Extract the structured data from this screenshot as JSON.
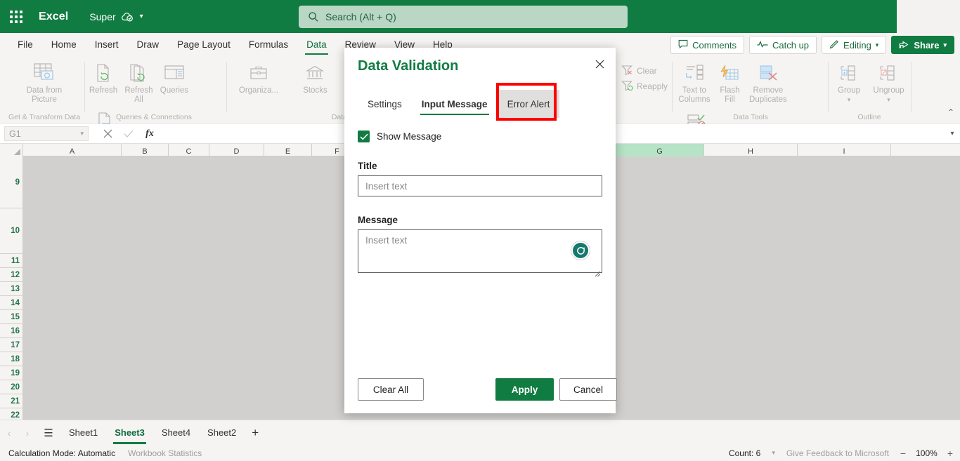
{
  "titlebar": {
    "app_name": "Excel",
    "file_name": "Super",
    "waffle_icon": "app-launcher-icon",
    "cloud_icon": "cloud-saved-icon",
    "file_chevron": "chevron-down-icon",
    "search": {
      "placeholder": "Search (Alt + Q)",
      "icon": "search-icon"
    }
  },
  "ribbon": {
    "tabs": [
      {
        "label": "File",
        "active": false
      },
      {
        "label": "Home",
        "active": false
      },
      {
        "label": "Insert",
        "active": false
      },
      {
        "label": "Draw",
        "active": false
      },
      {
        "label": "Page Layout",
        "active": false
      },
      {
        "label": "Formulas",
        "active": false
      },
      {
        "label": "Data",
        "active": true
      },
      {
        "label": "Review",
        "active": false
      },
      {
        "label": "View",
        "active": false
      },
      {
        "label": "Help",
        "active": false
      }
    ],
    "actions": {
      "comments": "Comments",
      "catch_up": "Catch up",
      "editing": "Editing",
      "share": "Share"
    },
    "groups": [
      {
        "label": "Get & Transform Data",
        "items": [
          "Data from Picture"
        ]
      },
      {
        "label": "Queries & Connections",
        "items": [
          "Refresh",
          "Refresh All",
          "Queries",
          "Workbook Links"
        ]
      },
      {
        "label": "Data",
        "items": [
          "Organiza...",
          "Stocks"
        ]
      },
      {
        "label": "Sort & Filter",
        "items": [
          "Clear",
          "Reapply"
        ]
      },
      {
        "label": "Data Tools",
        "items": [
          "Text to Columns",
          "Flash Fill",
          "Remove Duplicates",
          "Data Validation"
        ]
      },
      {
        "label": "Outline",
        "items": [
          "Group",
          "Ungroup"
        ]
      }
    ],
    "collapse_caret": "collapse-ribbon-caret"
  },
  "formula_bar": {
    "name_box_value": "G1",
    "name_box_chevron": "chevron-down-icon",
    "cancel_icon": "cancel-icon",
    "confirm_icon": "confirm-icon",
    "fx_label": "fx",
    "formula_value": "",
    "expand_chevron": "chevron-down-icon"
  },
  "grid": {
    "columns": [
      "A",
      "B",
      "C",
      "D",
      "E",
      "F",
      "G",
      "H",
      "I"
    ],
    "selected_column": "G",
    "rows": [
      "9",
      "10",
      "11",
      "12",
      "13",
      "14",
      "15",
      "16",
      "17",
      "18",
      "19",
      "20",
      "21",
      "22"
    ]
  },
  "dialog": {
    "title": "Data Validation",
    "close_icon": "close-icon",
    "tabs": [
      {
        "label": "Settings",
        "active": false,
        "highlighted": false
      },
      {
        "label": "Input Message",
        "active": true,
        "highlighted": false
      },
      {
        "label": "Error Alert",
        "active": false,
        "highlighted": true
      }
    ],
    "show_message": {
      "label": "Show Message",
      "checked": true,
      "check_icon": "checkmark-icon"
    },
    "title_field": {
      "label": "Title",
      "value": "",
      "placeholder": "Insert text"
    },
    "message_field": {
      "label": "Message",
      "value": "",
      "placeholder": "Insert text",
      "resize_handle": "resize-grip-icon"
    },
    "buttons": {
      "clear_all": "Clear All",
      "apply": "Apply",
      "cancel": "Cancel"
    },
    "highlight_color": "#ff0000",
    "accent_color": "#107c41",
    "cursor_indicator": "click-cursor-indicator"
  },
  "sheet_bar": {
    "prev_icon": "chevron-left-icon",
    "next_icon": "chevron-right-icon",
    "all_sheets_icon": "all-sheets-icon",
    "tabs": [
      {
        "label": "Sheet1",
        "active": false
      },
      {
        "label": "Sheet3",
        "active": true
      },
      {
        "label": "Sheet4",
        "active": false
      },
      {
        "label": "Sheet2",
        "active": false
      }
    ],
    "add_sheet_icon": "plus-icon"
  },
  "status_bar": {
    "calculation_mode": "Calculation Mode: Automatic",
    "workbook_statistics": "Workbook Statistics",
    "count": "Count: 6",
    "count_chevron": "chevron-down-icon",
    "feedback": "Give Feedback to Microsoft",
    "zoom_out": "−",
    "zoom_level": "100%",
    "zoom_in": "+"
  }
}
